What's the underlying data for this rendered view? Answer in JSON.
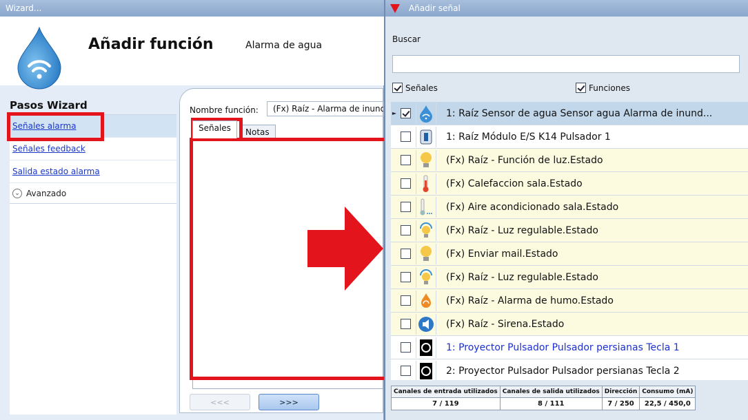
{
  "wizard": {
    "window_title": "Wizard...",
    "title": "Añadir función",
    "subtitle": "Alarma de agua",
    "steps_title": "Pasos Wizard",
    "steps": [
      {
        "label": "Señales alarma"
      },
      {
        "label": "Señales feedback"
      },
      {
        "label": "Salida estado alarma"
      }
    ],
    "advanced_label": "Avanzado",
    "function_name_label": "Nombre función:",
    "function_name_value": "(Fx) Raíz - Alarma de inundación",
    "tabs": [
      {
        "label": "Señales"
      },
      {
        "label": "Notas"
      }
    ],
    "prev_label": "<<<",
    "next_label": ">>>"
  },
  "signal_window": {
    "window_title": "Añadir señal",
    "search_label": "Buscar",
    "search_value": "",
    "filter_signals_label": "Señales",
    "filter_functions_label": "Funciones",
    "rows": [
      {
        "label": "1: Raíz Sensor de agua Sensor agua Alarma de inund...",
        "checked": true,
        "icon": "water-drop-icon"
      },
      {
        "label": "1: Raíz Módulo E/S K14 Pulsador 1",
        "checked": false,
        "icon": "io-module-icon"
      },
      {
        "label": "(Fx) Raíz - Función de luz.Estado",
        "checked": false,
        "icon": "light-bulb-icon"
      },
      {
        "label": "(Fx) Calefaccion sala.Estado",
        "checked": false,
        "icon": "thermometer-icon"
      },
      {
        "label": "(Fx) Aire acondicionado sala.Estado",
        "checked": false,
        "icon": "air-conditioner-icon"
      },
      {
        "label": "(Fx) Raíz - Luz regulable.Estado",
        "checked": false,
        "icon": "dimmable-light-icon"
      },
      {
        "label": "(Fx) Enviar mail.Estado",
        "checked": false,
        "icon": "light-bulb-icon"
      },
      {
        "label": "(Fx) Raíz - Luz regulable.Estado",
        "checked": false,
        "icon": "dimmable-light-icon"
      },
      {
        "label": "(Fx) Raíz - Alarma de humo.Estado",
        "checked": false,
        "icon": "smoke-alarm-icon"
      },
      {
        "label": "(Fx) Raíz - Sirena.Estado",
        "checked": false,
        "icon": "siren-icon"
      },
      {
        "label": "1: Proyector Pulsador Pulsador persianas Tecla 1",
        "checked": false,
        "icon": "push-button-icon"
      },
      {
        "label": "2: Proyector Pulsador Pulsador persianas Tecla 2",
        "checked": false,
        "icon": "push-button-icon"
      }
    ],
    "stats": {
      "headers": [
        "Canales de entrada utilizados",
        "Canales de salida utilizados",
        "Dirección",
        "Consumo (mA)"
      ],
      "values": [
        "7 / 119",
        "8 / 111",
        "7 / 250",
        "22,5 / 450,0"
      ]
    }
  },
  "colors": {
    "highlight": "#e3141c",
    "accent": "#2f8fd9",
    "link": "#1b37c8"
  }
}
